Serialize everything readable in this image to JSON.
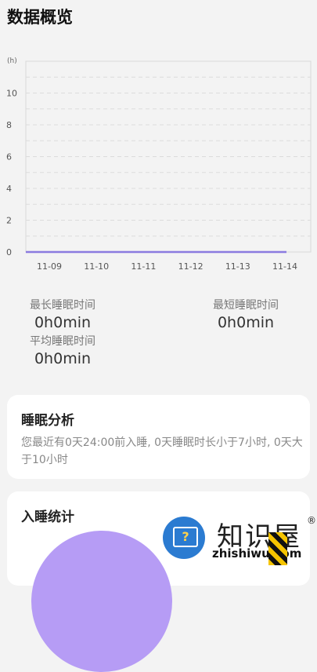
{
  "header": {
    "title": "数据概览"
  },
  "chart_data": {
    "type": "line",
    "ylabel": "(h)",
    "y_ticks": [
      "0",
      "2",
      "4",
      "6",
      "8",
      "10"
    ],
    "ylim": [
      0,
      12
    ],
    "categories": [
      "11-09",
      "11-10",
      "11-11",
      "11-12",
      "11-13",
      "11-14"
    ],
    "series": [
      {
        "values": [
          0,
          0,
          0,
          0,
          0,
          0
        ]
      }
    ],
    "grid": true,
    "line_color": "#8b7be0"
  },
  "stats": {
    "longest": {
      "label": "最长睡眠时间",
      "value": "0h0min"
    },
    "shortest": {
      "label": "最短睡眠时间",
      "value": "0h0min"
    },
    "average": {
      "label": "平均睡眠时间",
      "value": "0h0min"
    }
  },
  "analysis": {
    "title": "睡眠分析",
    "text": "您最近有0天24:00前入睡, 0天睡眠时长小于7小时, 0天大于10小时"
  },
  "sleep_stats": {
    "title": "入睡统计",
    "donut_color": "#b69cf5"
  },
  "watermark": {
    "brand": "知识屋",
    "reg": "®",
    "url": "zhishiwu.com",
    "icon_glyph": "?"
  }
}
